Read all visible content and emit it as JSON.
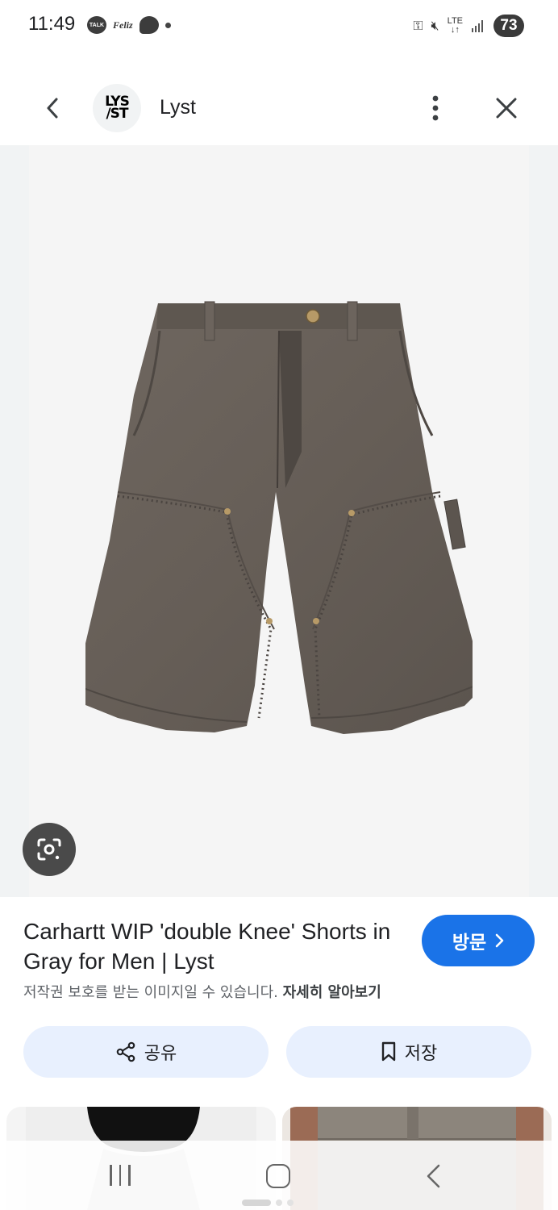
{
  "status_bar": {
    "time": "11:49",
    "talk_label": "TALK",
    "app2_label": "Feliz",
    "lte_top": "LTE",
    "lte_bottom": "↓↑",
    "battery": "73"
  },
  "header": {
    "logo_line1": "LYS",
    "logo_line2": "/ST",
    "site_name": "Lyst"
  },
  "product": {
    "title": "Carhartt WIP 'double Knee' Shorts in Gray for Men | Lyst",
    "visit_label": "방문",
    "copyright_text": "저작권 보호를 받는 이미지일 수 있습니다.",
    "learn_more": "자세히 알아보기",
    "share_label": "공유",
    "save_label": "저장"
  },
  "colors": {
    "accent": "#1a73e8",
    "chip_bg": "#e8f0fe",
    "image_bg": "#f1f3f4",
    "fabric": "#6b635c"
  },
  "icons": {
    "back": "chevron-left-icon",
    "more": "more-vert-icon",
    "close": "close-icon",
    "lens": "google-lens-icon",
    "share": "share-icon",
    "save": "bookmark-icon"
  }
}
